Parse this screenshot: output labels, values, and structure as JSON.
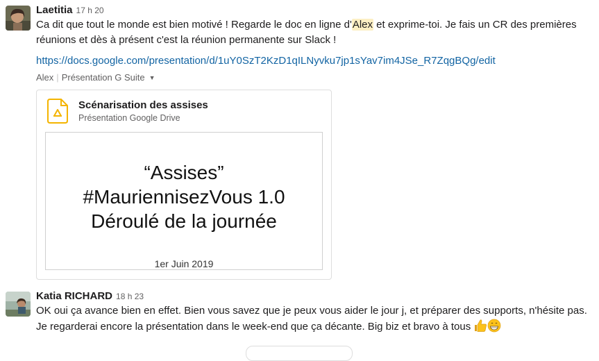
{
  "messages": [
    {
      "sender": "Laetitia",
      "time": "17 h 20",
      "text_before": "Ca dit que tout le monde est bien motivé ! Regarde le doc en ligne d'",
      "mention": "Alex",
      "text_after": " et exprime-toi. Je fais un CR des premières réunions et dès à présent c'est la réunion permanente sur Slack !",
      "link": "https://docs.google.com/presentation/d/1uY0SzT2KzD1qILNyvku7jp1sYav7im4JSe_R7ZqgBQg/edit",
      "attachment": {
        "author": "Alex",
        "service": "Présentation G Suite",
        "title": "Scénarisation des assises",
        "subtitle": "Présentation Google Drive",
        "slide_lines": [
          "“Assises”",
          "#MauriennisezVous 1.0",
          "Déroulé de la journée"
        ],
        "slide_date": "1er Juin 2019"
      }
    },
    {
      "sender": "Katia RICHARD",
      "time": "18 h 23",
      "text": "OK oui ça avance bien en effet. Bien vous savez que je peux vous aider le jour j, et préparer des supports, n'hésite pas. Je regarderai encore la présentation dans le week-end que ça décante. Big biz et bravo à tous ",
      "emojis": [
        "thumbs-up",
        "grinning-face"
      ]
    }
  ],
  "colors": {
    "link": "#1264a3",
    "mention_bg": "#fcefc3",
    "drive_yellow": "#f4b400"
  }
}
